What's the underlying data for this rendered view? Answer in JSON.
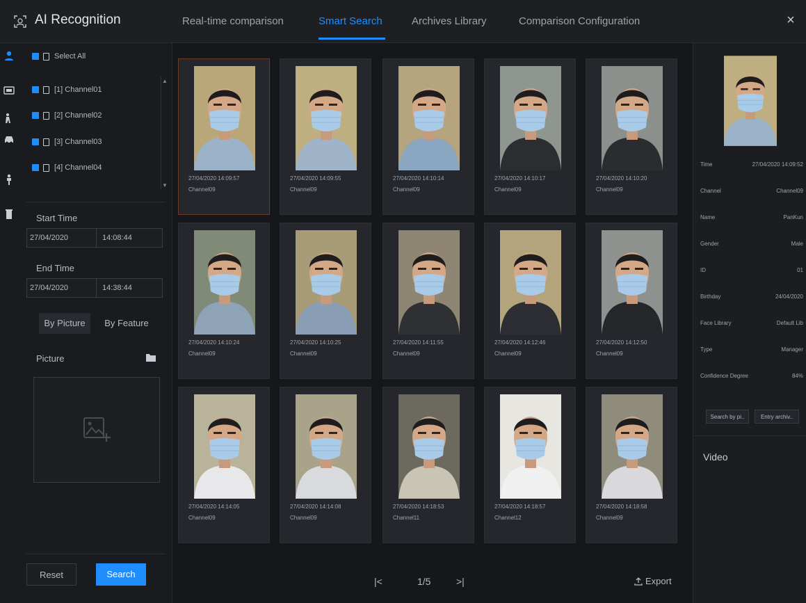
{
  "app": {
    "title": "AI Recognition",
    "close_symbol": "×"
  },
  "tabs": [
    {
      "label": "Real-time comparison"
    },
    {
      "label": "Smart Search"
    },
    {
      "label": "Archives Library"
    },
    {
      "label": "Comparison Configuration"
    }
  ],
  "active_tab": "Smart Search",
  "accent_color": "#1e8eff",
  "rail_icons": [
    "face-icon",
    "license-plate-icon",
    "person-icon",
    "vehicle-icon",
    "body-icon",
    "trash-icon"
  ],
  "channels": {
    "select_all": "Select All",
    "items": [
      {
        "label": "[1] Channel01"
      },
      {
        "label": "[2] Channel02"
      },
      {
        "label": "[3] Channel03"
      },
      {
        "label": "[4] Channel04"
      }
    ]
  },
  "time": {
    "start_label": "Start Time",
    "start_date": "27/04/2020",
    "start_time": "14:08:44",
    "end_label": "End Time",
    "end_date": "27/04/2020",
    "end_time": "14:38:44"
  },
  "search_mode": {
    "by_picture": "By Picture",
    "by_feature": "By Feature",
    "active": "By Picture"
  },
  "picture_label": "Picture",
  "buttons": {
    "reset": "Reset",
    "search": "Search",
    "export": "Export"
  },
  "results": [
    {
      "time": "27/04/2020 14:09:57",
      "channel": "Channel09",
      "bg": "#b9a77a",
      "shirt": "#9bb3c8"
    },
    {
      "time": "27/04/2020 14:09:55",
      "channel": "Channel09",
      "bg": "#bfae7f",
      "shirt": "#9fb3c9"
    },
    {
      "time": "27/04/2020 14:10:14",
      "channel": "Channel09",
      "bg": "#b5a47e",
      "shirt": "#8aa6c0"
    },
    {
      "time": "27/04/2020 14:10:17",
      "channel": "Channel09",
      "bg": "#8f958f",
      "shirt": "#2b2d31"
    },
    {
      "time": "27/04/2020 14:10:20",
      "channel": "Channel09",
      "bg": "#8b908d",
      "shirt": "#2a2c30"
    },
    {
      "time": "27/04/2020 14:10:24",
      "channel": "Channel09",
      "bg": "#7f8b76",
      "shirt": "#8ea3b8"
    },
    {
      "time": "27/04/2020 14:10:25",
      "channel": "Channel09",
      "bg": "#a89b78",
      "shirt": "#8a9fb5"
    },
    {
      "time": "27/04/2020 14:11:55",
      "channel": "Channel09",
      "bg": "#8e8672",
      "shirt": "#2e3034"
    },
    {
      "time": "27/04/2020 14:12:46",
      "channel": "Channel09",
      "bg": "#b3a47c",
      "shirt": "#2c2e33"
    },
    {
      "time": "27/04/2020 14:12:50",
      "channel": "Channel09",
      "bg": "#8d928f",
      "shirt": "#25272b"
    },
    {
      "time": "27/04/2020 14:14:05",
      "channel": "Channel09",
      "bg": "#b9b39b",
      "shirt": "#e8e8ea"
    },
    {
      "time": "27/04/2020 14:14:08",
      "channel": "Channel09",
      "bg": "#a9a38a",
      "shirt": "#d8dadd"
    },
    {
      "time": "27/04/2020 14:18:53",
      "channel": "Channel11",
      "bg": "#6c6a5f",
      "shirt": "#c9c4b4"
    },
    {
      "time": "27/04/2020 14:18:57",
      "channel": "Channel12",
      "bg": "#e8e6e1",
      "shirt": "#f0f0f0"
    },
    {
      "time": "27/04/2020 14:18:58",
      "channel": "Channel09",
      "bg": "#908c7c",
      "shirt": "#d9d9db"
    }
  ],
  "pagination": {
    "current": "1/5",
    "first_symbol": "|<",
    "last_symbol": ">|"
  },
  "detail": {
    "rows": [
      {
        "label": "Time",
        "value": "27/04/2020 14:09:52"
      },
      {
        "label": "Channel",
        "value": "Channel09"
      },
      {
        "label": "Name",
        "value": "PanKun"
      },
      {
        "label": "Gender",
        "value": "Male"
      },
      {
        "label": "ID",
        "value": "01"
      },
      {
        "label": "Birthday",
        "value": "24/04/2020"
      },
      {
        "label": "Face Library",
        "value": "Default Lib"
      },
      {
        "label": "Type",
        "value": "Manager"
      },
      {
        "label": "Confidence Degree",
        "value": "84%"
      }
    ],
    "search_by_pic": "Search by pi..",
    "entry_archive": "Entry archiv..",
    "video_label": "Video"
  }
}
